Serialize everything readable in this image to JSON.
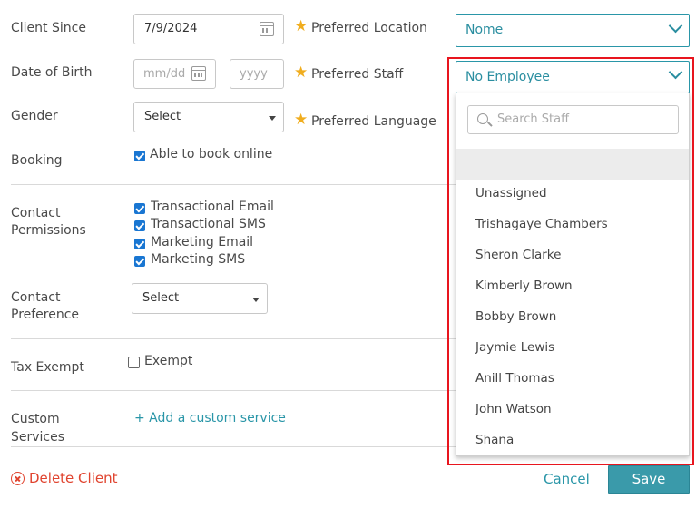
{
  "form": {
    "client_since_label": "Client Since",
    "client_since_value": "7/9/2024",
    "dob_label": "Date of Birth",
    "dob_mmdd_placeholder": "mm/dd",
    "dob_yyyy_placeholder": "yyyy",
    "gender_label": "Gender",
    "gender_value": "Select",
    "booking_label": "Booking",
    "booking_option": "Able to book online",
    "contact_permissions_label_1": "Contact",
    "contact_permissions_label_2": "Permissions",
    "permissions": [
      {
        "label": "Transactional Email",
        "checked": true
      },
      {
        "label": "Transactional SMS",
        "checked": true
      },
      {
        "label": "Marketing Email",
        "checked": true
      },
      {
        "label": "Marketing SMS",
        "checked": true
      }
    ],
    "contact_preference_label_1": "Contact",
    "contact_preference_label_2": "Preference",
    "contact_preference_value": "Select",
    "tax_exempt_label": "Tax Exempt",
    "tax_exempt_option": "Exempt",
    "custom_services_label_1": "Custom",
    "custom_services_label_2": "Services",
    "add_custom_service": "+ Add a custom service"
  },
  "preferences": {
    "location_label": "Preferred Location",
    "location_value": "Nome",
    "staff_label": "Preferred Staff",
    "staff_value": "No Employee",
    "language_label": "Preferred Language"
  },
  "staff_dropdown": {
    "search_placeholder": "Search Staff",
    "options": [
      "",
      "Unassigned",
      "Trishagaye Chambers",
      "Sheron Clarke",
      "Kimberly Brown",
      "Bobby Brown",
      "Jaymie Lewis",
      "Anill Thomas",
      "John Watson",
      "Shana"
    ]
  },
  "footer": {
    "delete_label": "Delete Client",
    "cancel_label": "Cancel",
    "save_label": "Save"
  },
  "colors": {
    "accent": "#2a96a8",
    "danger": "#e0442f",
    "star": "#f0ad1e",
    "highlight": "#e8151e",
    "checkbox": "#1976d2"
  },
  "icons": {
    "date": "calendar-icon",
    "search": "search-icon",
    "delete": "x-circle-icon",
    "required": "star-icon",
    "dropdown": "chevron-down-icon"
  }
}
